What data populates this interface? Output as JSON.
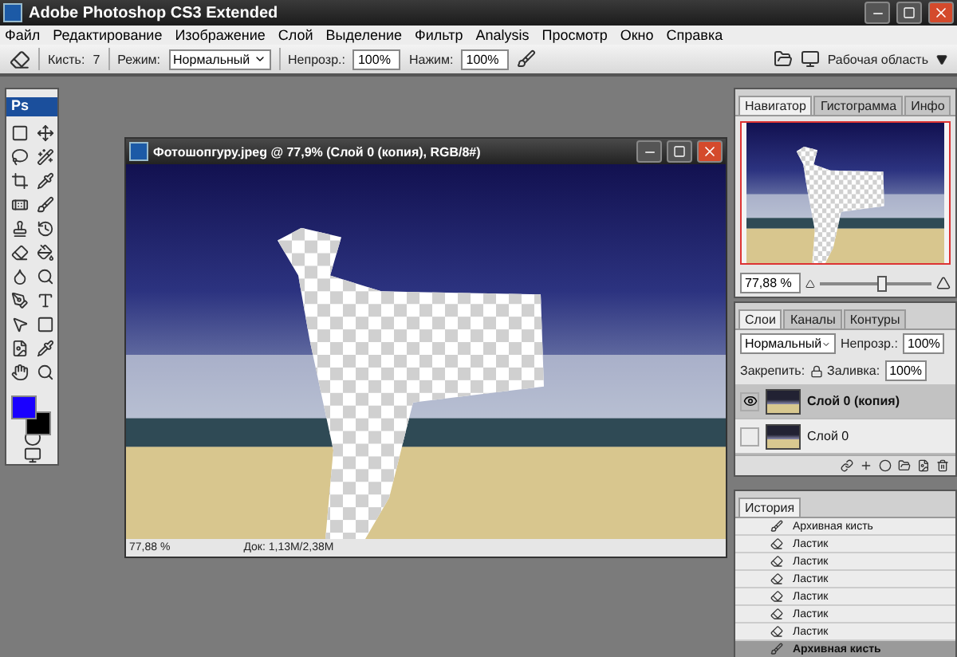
{
  "window": {
    "title": "Adobe Photoshop CS3 Extended"
  },
  "menu": [
    "Файл",
    "Редактирование",
    "Изображение",
    "Слой",
    "Выделение",
    "Фильтр",
    "Analysis",
    "Просмотр",
    "Окно",
    "Справка"
  ],
  "options_bar": {
    "brush_label": "Кисть:",
    "brush_size": "7",
    "mode_label": "Режим:",
    "mode_value": "Нормальный",
    "opacity_label": "Непрозр.:",
    "opacity_value": "100%",
    "flow_label": "Нажим:",
    "flow_value": "100%",
    "workspace": "Рабочая область"
  },
  "toolbox": {
    "logo": "Ps"
  },
  "document": {
    "title": "Фотошопгуру.jpeg @ 77,9% (Слой 0 (копия), RGB/8#)",
    "zoom": "77,88 %",
    "info": "Док: 1,13M/2,38M"
  },
  "navigator": {
    "tabs": [
      {
        "label": "Навигатор",
        "selected": true
      },
      {
        "label": "Гистограмма",
        "selected": false
      },
      {
        "label": "Инфо",
        "selected": false
      }
    ],
    "zoom": "77,88 %",
    "level": 0.55
  },
  "layers": {
    "tabs": [
      {
        "label": "Слои",
        "selected": true
      },
      {
        "label": "Каналы",
        "selected": false
      },
      {
        "label": "Контуры",
        "selected": false
      }
    ],
    "blend_mode": "Нормальный",
    "opacity_label": "Непрозр.:",
    "opacity_value": "100%",
    "lock_label": "Закрепить:",
    "fill_label": "Заливка:",
    "fill_value": "100%",
    "items": [
      {
        "name": "Слой 0 (копия)",
        "selected": true,
        "visible": true
      },
      {
        "name": "Слой 0",
        "selected": false,
        "visible": false
      }
    ]
  },
  "history": {
    "tab": "История",
    "items": [
      {
        "label": "Архивная кисть",
        "kind": "brush",
        "selected": false
      },
      {
        "label": "Ластик",
        "kind": "eraser",
        "selected": false
      },
      {
        "label": "Ластик",
        "kind": "eraser",
        "selected": false
      },
      {
        "label": "Ластик",
        "kind": "eraser",
        "selected": false
      },
      {
        "label": "Ластик",
        "kind": "eraser",
        "selected": false
      },
      {
        "label": "Ластик",
        "kind": "eraser",
        "selected": false
      },
      {
        "label": "Ластик",
        "kind": "eraser",
        "selected": false
      },
      {
        "label": "Архивная кисть",
        "kind": "brush",
        "selected": true
      }
    ]
  }
}
